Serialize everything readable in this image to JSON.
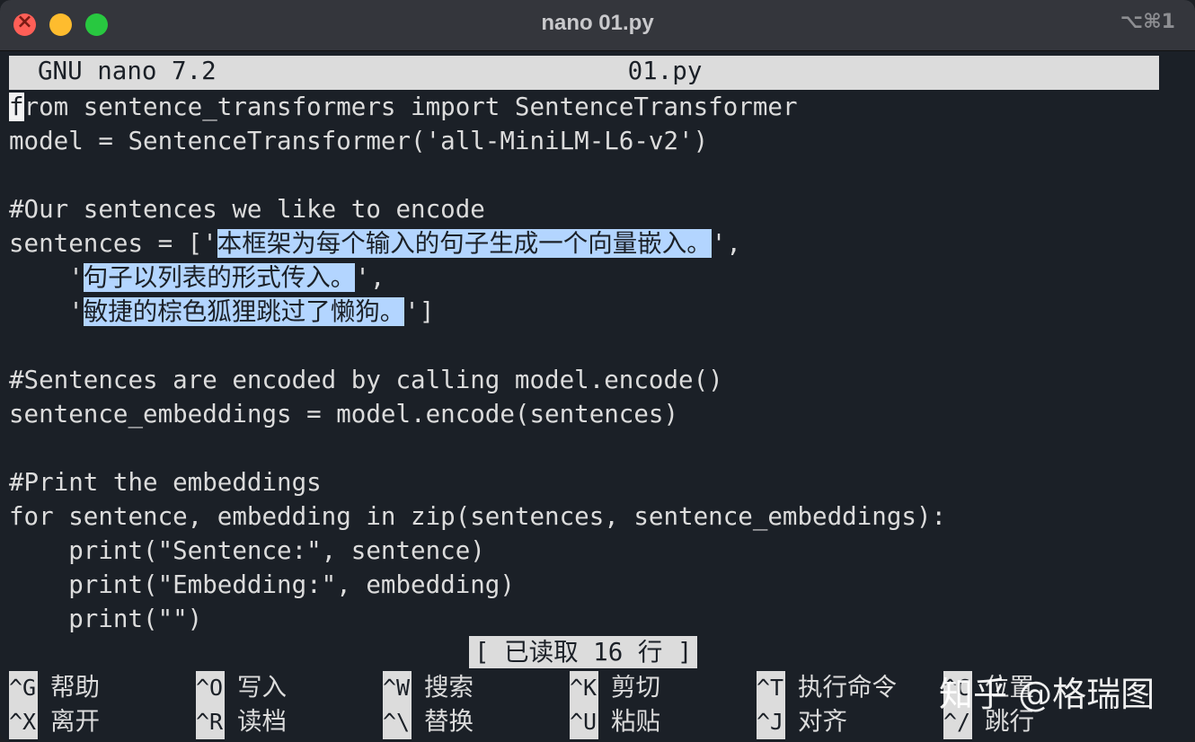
{
  "window": {
    "title": "nano 01.py",
    "shortcut": "⌥⌘1"
  },
  "header": {
    "app": "GNU nano 7.2",
    "file": "01.py"
  },
  "code": {
    "l1_cursor": "f",
    "l1_rest": "rom sentence_transformers import SentenceTransformer",
    "l2": "model = SentenceTransformer('all-MiniLM-L6-v2')",
    "l4": "#Our sentences we like to encode",
    "l5_pre": "sentences = ['",
    "l5_hl": "本框架为每个输入的句子生成一个向量嵌入。",
    "l5_post": "',",
    "l6_pre": "    '",
    "l6_hl": "句子以列表的形式传入。",
    "l6_post": "',",
    "l7_pre": "    '",
    "l7_hl": "敏捷的棕色狐狸跳过了懒狗。",
    "l7_post": "']",
    "l9": "#Sentences are encoded by calling model.encode()",
    "l10": "sentence_embeddings = model.encode(sentences)",
    "l12": "#Print the embeddings",
    "l13": "for sentence, embedding in zip(sentences, sentence_embeddings):",
    "l14": "    print(\"Sentence:\", sentence)",
    "l15": "    print(\"Embedding:\", embedding)",
    "l16": "    print(\"\")"
  },
  "status": "[ 已读取 16 行 ]",
  "shortcuts": [
    {
      "key": "^G",
      "label": "帮助"
    },
    {
      "key": "^O",
      "label": "写入"
    },
    {
      "key": "^W",
      "label": "搜索"
    },
    {
      "key": "^K",
      "label": "剪切"
    },
    {
      "key": "^T",
      "label": "执行命令"
    },
    {
      "key": "^C",
      "label": "位置"
    },
    {
      "key": "^X",
      "label": "离开"
    },
    {
      "key": "^R",
      "label": "读档"
    },
    {
      "key": "^\\",
      "label": "替换"
    },
    {
      "key": "^U",
      "label": "粘贴"
    },
    {
      "key": "^J",
      "label": "对齐"
    },
    {
      "key": "^/",
      "label": "跳行"
    }
  ],
  "watermark": "知乎 @格瑞图"
}
